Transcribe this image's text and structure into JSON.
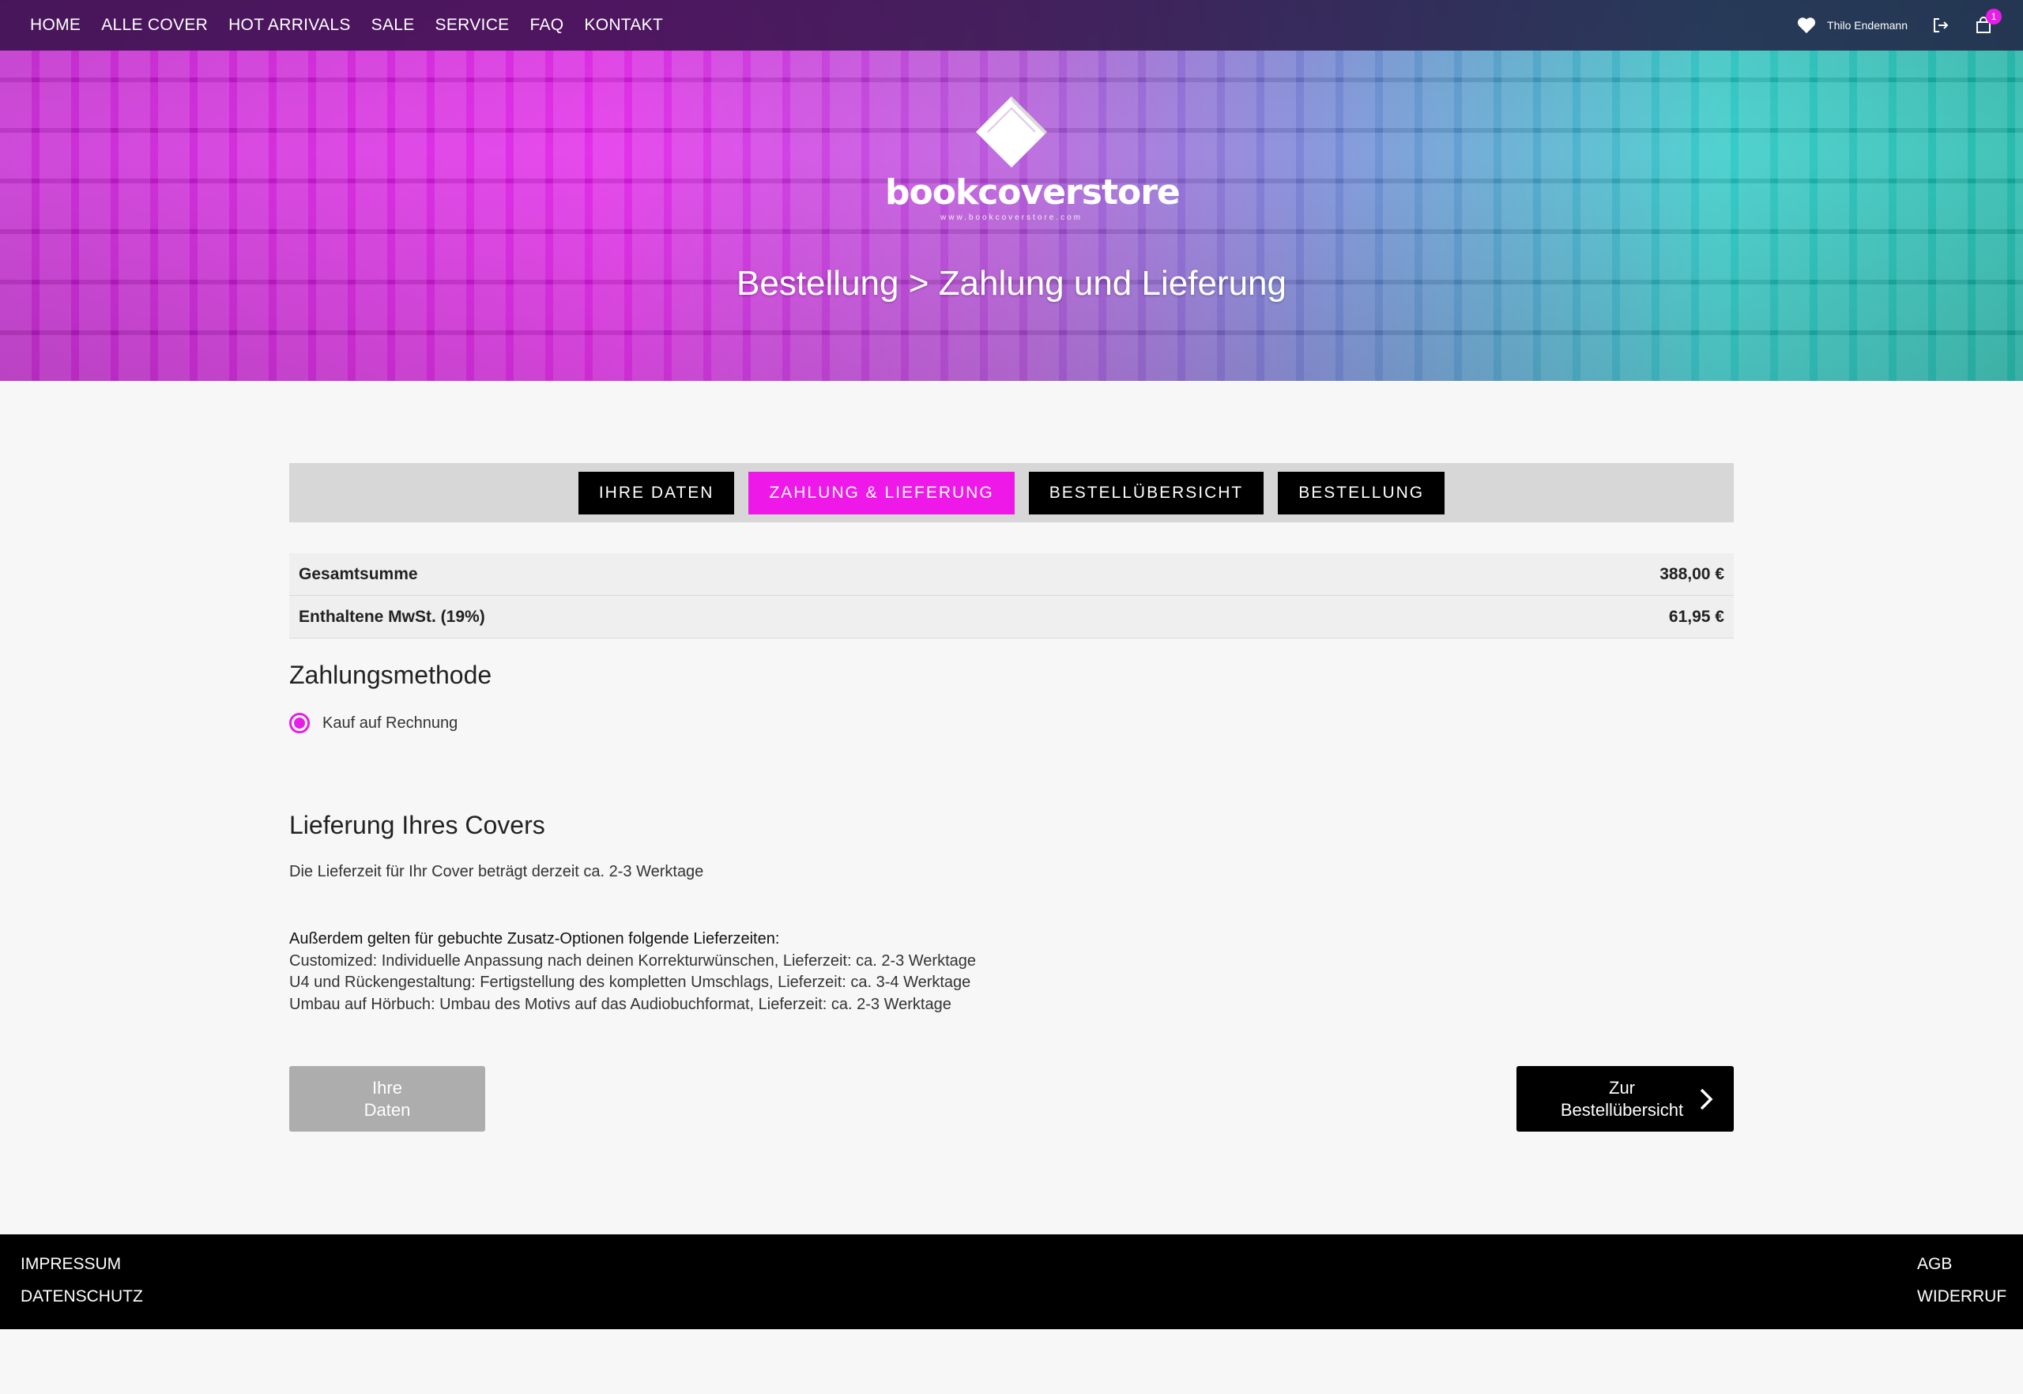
{
  "nav": {
    "items": [
      "HOME",
      "ALLE COVER",
      "HOT ARRIVALS",
      "SALE",
      "SERVICE",
      "FAQ",
      "KONTAKT"
    ],
    "user_name": "Thilo Endemann",
    "cart_count": "1"
  },
  "hero": {
    "logo_text": "bookcoverstore",
    "logo_url": "www.bookcoverstore.com",
    "title": "Bestellung > Zahlung und Lieferung"
  },
  "steps": [
    "IHRE DATEN",
    "ZAHLUNG & LIEFERUNG",
    "BESTELLÜBERSICHT",
    "BESTELLUNG"
  ],
  "totals": [
    {
      "label": "Gesamtsumme",
      "value": "388,00 €"
    },
    {
      "label": "Enthaltene MwSt. (19%)",
      "value": "61,95 €"
    }
  ],
  "payment": {
    "heading": "Zahlungsmethode",
    "option": "Kauf auf Rechnung"
  },
  "delivery": {
    "heading": "Lieferung Ihres Covers",
    "text": "Die Lieferzeit für Ihr Cover beträgt derzeit ca. 2-3 Werktage",
    "intro": "Außerdem gelten für gebuchte Zusatz-Optionen folgende Lieferzeiten:",
    "lines": [
      "Customized: Individuelle Anpassung nach deinen Korrekturwünschen, Lieferzeit: ca. 2-3 Werktage",
      "U4 und Rückengestaltung: Fertigstellung des kompletten Umschlags, Lieferzeit: ca. 3-4 Werktage",
      "Umbau auf Hörbuch: Umbau des Motivs auf das Audiobuchformat, Lieferzeit: ca. 2-3 Werktage"
    ]
  },
  "buttons": {
    "back_line1": "Ihre",
    "back_line2": "Daten",
    "next_line1": "Zur",
    "next_line2": "Bestellübersicht"
  },
  "footer": {
    "impressum": "IMPRESSUM",
    "datenschutz": "DATENSCHUTZ",
    "agb": "AGB",
    "widerruf": "WIDERRUF"
  },
  "colors": {
    "accent": "#ee18e8",
    "step_bg": "#000000",
    "back_button": "#adadad"
  }
}
